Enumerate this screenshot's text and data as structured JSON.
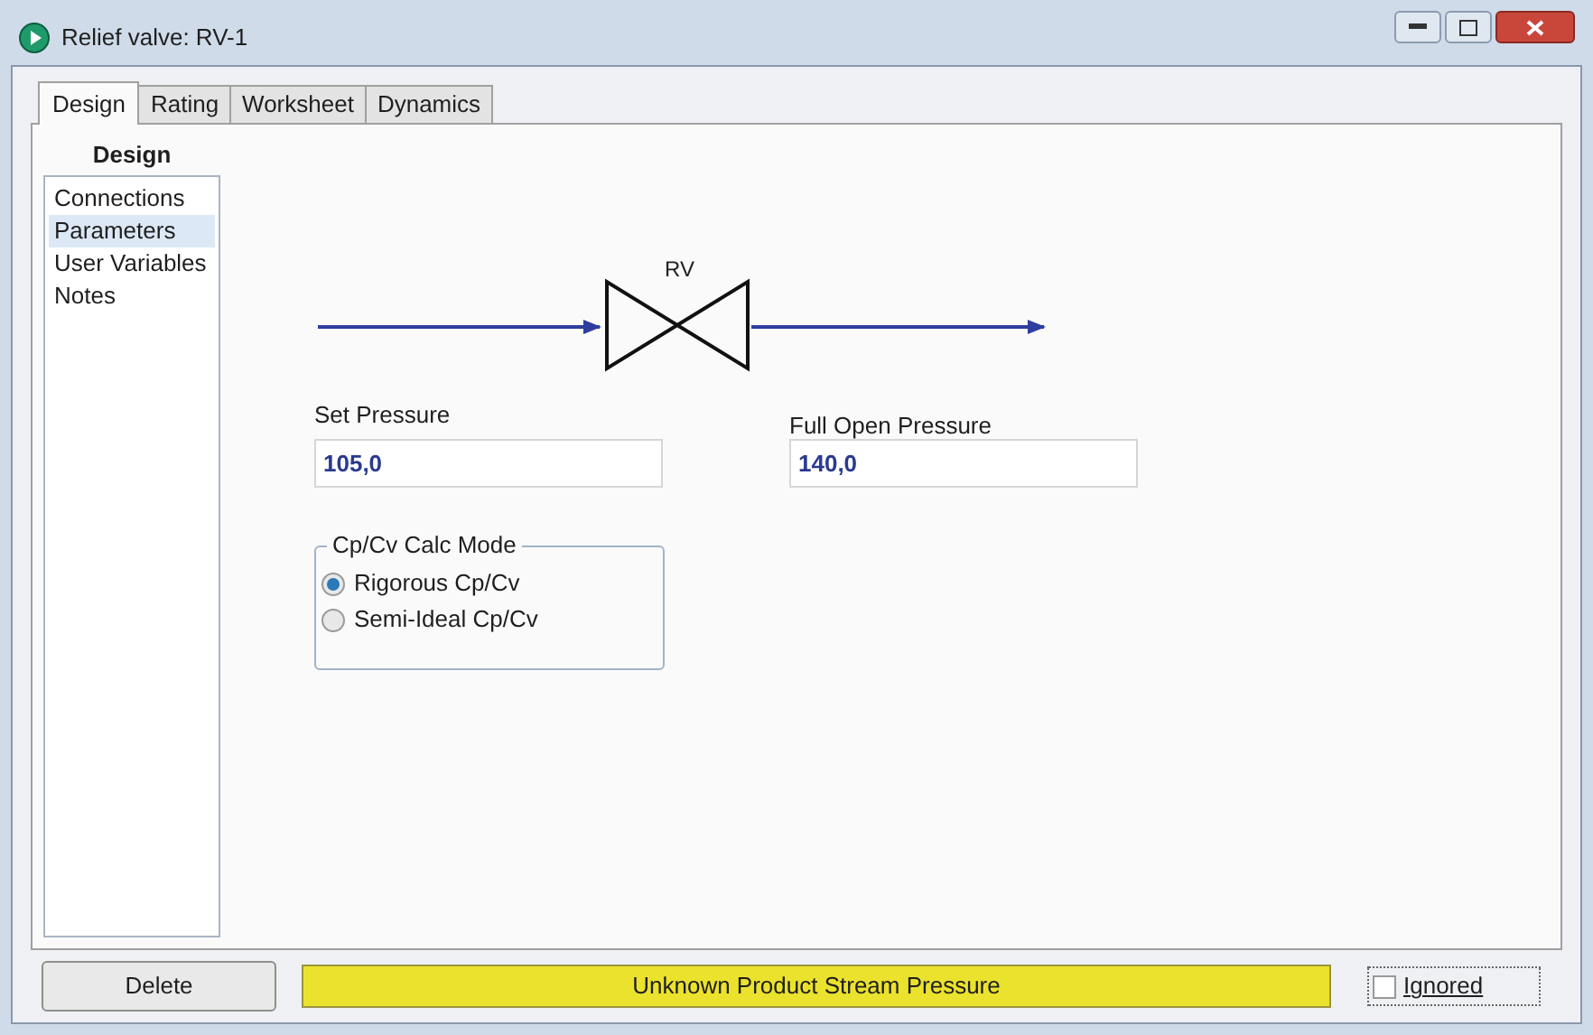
{
  "window": {
    "title": "Relief valve: RV-1"
  },
  "tabs": [
    {
      "label": "Design",
      "selected": true
    },
    {
      "label": "Rating",
      "selected": false
    },
    {
      "label": "Worksheet",
      "selected": false
    },
    {
      "label": "Dynamics",
      "selected": false
    }
  ],
  "sidebar": {
    "title": "Design",
    "items": [
      {
        "label": "Connections",
        "selected": false
      },
      {
        "label": "Parameters",
        "selected": true
      },
      {
        "label": "User Variables",
        "selected": false
      },
      {
        "label": "Notes",
        "selected": false
      }
    ]
  },
  "diagram": {
    "valve_label": "RV"
  },
  "fields": [
    {
      "label": "Set Pressure",
      "value": "105,0"
    },
    {
      "label": "Full Open Pressure",
      "value": "140,0"
    }
  ],
  "calc_mode": {
    "title": "Cp/Cv Calc Mode",
    "options": [
      {
        "label": "Rigorous Cp/Cv",
        "selected": true
      },
      {
        "label": "Semi-Ideal Cp/Cv",
        "selected": false
      }
    ]
  },
  "footer": {
    "delete_button": "Delete",
    "status": "Unknown Product Stream Pressure",
    "ignored": {
      "label": "Ignored",
      "checked": false
    }
  }
}
